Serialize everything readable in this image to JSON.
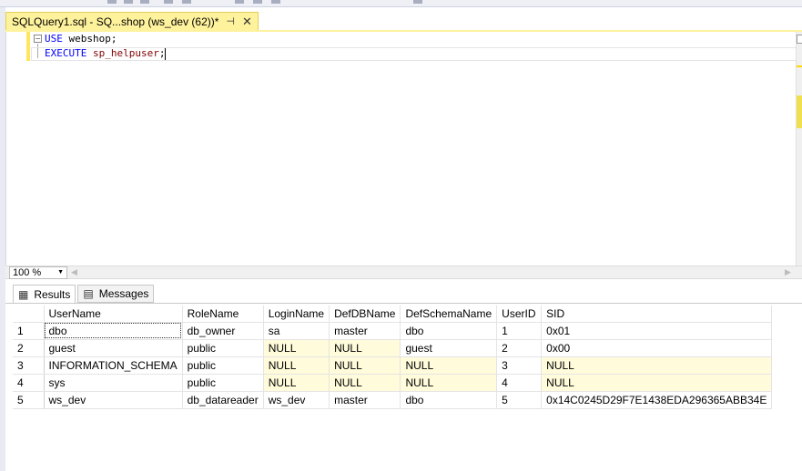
{
  "doc_tab": {
    "title": "SQLQuery1.sql - SQ...shop (ws_dev (62))*",
    "pin_glyph": "⊣",
    "close_glyph": "✕"
  },
  "editor": {
    "lines": [
      {
        "keyword": "USE",
        "rest": " webshop;"
      },
      {
        "keyword": "EXECUTE",
        "proc": " sp_helpuser",
        "tail": ";"
      }
    ]
  },
  "zoom": {
    "value": "100 %"
  },
  "results_tabs": [
    {
      "label": "Results",
      "icon": "grid-icon"
    },
    {
      "label": "Messages",
      "icon": "messages-icon"
    }
  ],
  "grid": {
    "columns": [
      "UserName",
      "RoleName",
      "LoginName",
      "DefDBName",
      "DefSchemaName",
      "UserID",
      "SID"
    ],
    "rows": [
      {
        "num": "1",
        "cells": [
          "dbo",
          "db_owner",
          "sa",
          "master",
          "dbo",
          "1",
          "0x01"
        ]
      },
      {
        "num": "2",
        "cells": [
          "guest",
          "public",
          "NULL",
          "NULL",
          "guest",
          "2",
          "0x00"
        ]
      },
      {
        "num": "3",
        "cells": [
          "INFORMATION_SCHEMA",
          "public",
          "NULL",
          "NULL",
          "NULL",
          "3",
          "NULL"
        ]
      },
      {
        "num": "4",
        "cells": [
          "sys",
          "public",
          "NULL",
          "NULL",
          "NULL",
          "4",
          "NULL"
        ]
      },
      {
        "num": "5",
        "cells": [
          "ws_dev",
          "db_datareader",
          "ws_dev",
          "master",
          "dbo",
          "5",
          "0x14C0245D29F7E1438EDA296365ABB34E"
        ]
      }
    ]
  },
  "colors": {
    "tab_active": "#fff29d",
    "keyword": "#0000ff",
    "proc": "#800000",
    "null_cell": "#fffbdb"
  }
}
